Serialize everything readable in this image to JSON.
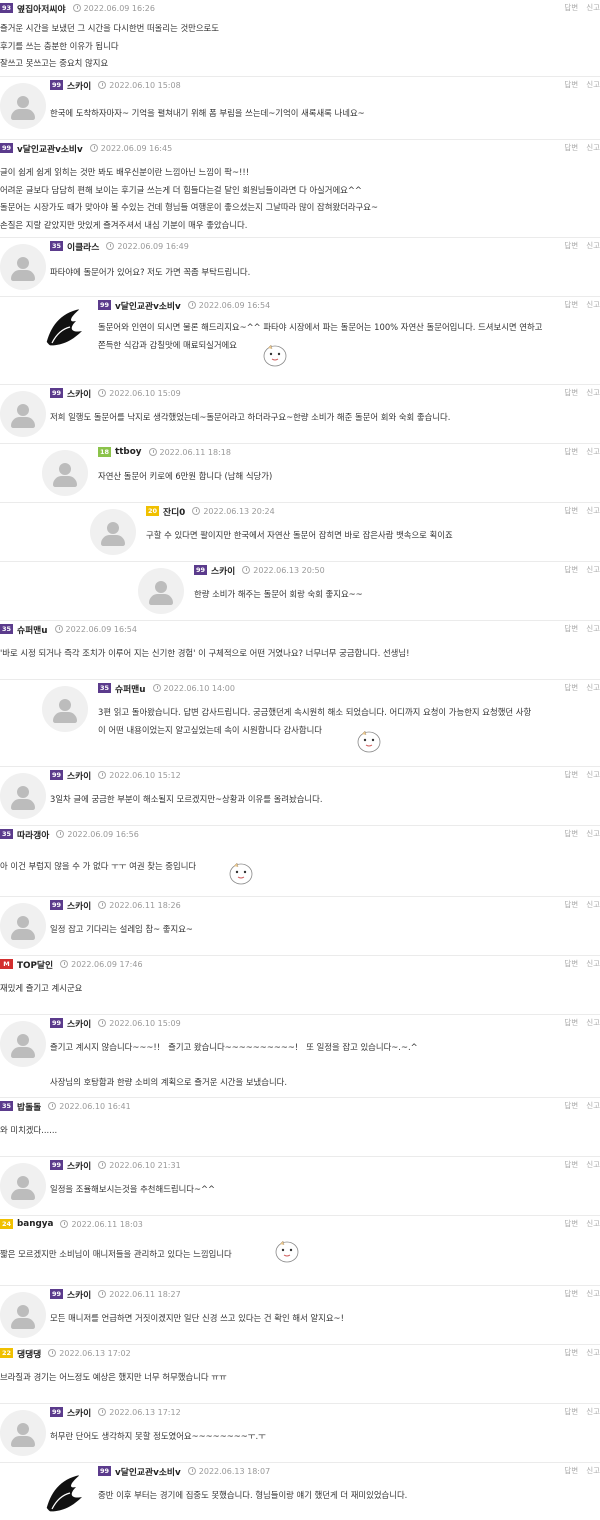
{
  "actions": {
    "reply": "답변",
    "report": "신고"
  },
  "comments": [
    {
      "level": "93",
      "level_color": "#5b3b8c",
      "nick": "옆집아저씨야",
      "date": "2022.06.09 16:26",
      "avatar": "none",
      "lines": [
        "즐거운 시간을 보냈던 그 시간을 다시한번 떠올리는 것만으로도",
        "후기를 쓰는 충분한 이유가 됩니다",
        "잘쓰고 못쓰고는 중요치 않지요"
      ]
    },
    {
      "level": "99",
      "level_color": "#5b3b8c",
      "nick": "스카이",
      "date": "2022.06.10 15:08",
      "avatar": "default",
      "lines": [
        "한국에 도착하자마자~ 기억을 펼쳐내기 위해 폼 부림을 쓰는데~기억이 새록새록 나네요~"
      ]
    },
    {
      "level": "99",
      "level_color": "#5b3b8c",
      "nick": "v달인교관v소비v",
      "date": "2022.06.09 16:45",
      "avatar": "none",
      "lines": [
        "글이 쉽게 쉽게 읽히는 것만 봐도 배우신분이란 느낌아닌 느낌이 팍~!!!",
        "어려운 글보다 담담히 편해 보이는 후기글 쓰는게 더 힘들다는걸 달인 회원님들이라면 다 아실거에요^^",
        "돌문어는 시장가도 때가 맞아야 볼 수있는 건데 형님들 여행운이 좋으셨는지 그날따라 많이 잡혀왔더라구요~",
        "손질은 지랄 같았지만 맛있게 즐겨주셔서 내심 기분이 매우 좋았습니다."
      ]
    },
    {
      "level": "35",
      "level_color": "#5b3b8c",
      "nick": "이클라스",
      "date": "2022.06.09 16:49",
      "avatar": "default",
      "lines": [
        "파타야에 돌문어가 있어요? 저도 가면 꼭좀 부탁드립니다."
      ]
    },
    {
      "level": "99",
      "level_color": "#5b3b8c",
      "nick": "v달인교관v소비v",
      "date": "2022.06.09 16:54",
      "avatar": "dark",
      "emoticon": "emo",
      "lines": [
        "돌문어와 인연이 되시면 물론 해드리지요~^^ 파타야 시장에서 파는 돌문어는 100% 자연산 돌문어입니다. 드셔보시면 연하고",
        "쫀득한 식감과 감칠맛에 매료되실거에요"
      ]
    },
    {
      "level": "99",
      "level_color": "#5b3b8c",
      "nick": "스카이",
      "date": "2022.06.10 15:09",
      "avatar": "default",
      "lines": [
        "저희 일행도 돌문어를 낙지로 생각했었는데~돌문어라고 하더라구요~한량 소비가 해준 돌문어 회와 숙회 좋습니다."
      ]
    },
    {
      "level": "18",
      "level_color": "#8bc34a",
      "nick": "ttboy",
      "date": "2022.06.11 18:18",
      "avatar": "default",
      "lines": [
        "자연산 돌문어 키로에 6만원 합니다 (남해 식당가)"
      ]
    },
    {
      "level": "20",
      "level_color": "#f0c000",
      "nick": "잔디0",
      "date": "2022.06.13 20:24",
      "avatar": "default",
      "lines": [
        "구할 수 있다면 팔이지만 한국에서 자연산 돌문어 잡히면 바로 잡은사람 뱃속으로 획이죠"
      ]
    },
    {
      "level": "99",
      "level_color": "#5b3b8c",
      "nick": "스카이",
      "date": "2022.06.13 20:50",
      "avatar": "default",
      "lines": [
        "한량 소비가 해주는 돌문어 회랑 숙회 좋지요~~"
      ]
    },
    {
      "level": "35",
      "level_color": "#5b3b8c",
      "nick": "슈퍼맨u",
      "date": "2022.06.09 16:54",
      "avatar": "none",
      "lines": [
        "'바로 시정 되거나 즉각 조치가 이루어 지는 신기한 경험' 이 구체적으로 어떤 거였나요? 너무너무 궁금합니다. 선생님!"
      ]
    },
    {
      "level": "35",
      "level_color": "#5b3b8c",
      "nick": "슈퍼맨u",
      "date": "2022.06.10 14:00",
      "avatar": "default",
      "emoticon": "emo",
      "lines": [
        "3편 읽고 돌아왔습니다. 답변 감사드립니다. 궁금했던게 속시원히 해소 되었습니다. 어디까지 요청이 가능한지 요청했던 사항",
        "이 어떤 내용이었는지 알고싶었는데 속이 시원합니다 감사합니다"
      ]
    },
    {
      "level": "99",
      "level_color": "#5b3b8c",
      "nick": "스카이",
      "date": "2022.06.10 15:12",
      "avatar": "default",
      "lines": [
        "3일차 글에 궁금한 부분이 해소될지 모르겠지만~상황과 이유를 올려놨습니다."
      ]
    },
    {
      "level": "35",
      "level_color": "#5b3b8c",
      "nick": "따라갱아",
      "date": "2022.06.09 16:56",
      "avatar": "none",
      "emoticon": "emo",
      "lines": [
        "아 이건 부럽지 않을 수 가 없다 ㅜㅜ 여권 찾는 중입니다"
      ]
    },
    {
      "level": "99",
      "level_color": "#5b3b8c",
      "nick": "스카이",
      "date": "2022.06.11 18:26",
      "avatar": "default",
      "lines": [
        "일정 잡고 기다리는 설레임 참~ 좋지요~"
      ]
    },
    {
      "level": "M",
      "level_color": "#d32f2f",
      "nick": "TOP달인",
      "date": "2022.06.09 17:46",
      "avatar": "none",
      "lines": [
        "재밌게 즐기고 계시군요"
      ]
    },
    {
      "level": "99",
      "level_color": "#5b3b8c",
      "nick": "스카이",
      "date": "2022.06.10 15:09",
      "avatar": "default",
      "lines": [
        "즐기고 계시지 않습니다~~~!!   즐기고 왔습니다~~~~~~~~~~!   또 일정을 잡고 있습니다~.~.^",
        "",
        "사장님의 호탕함과 한량 소비의 계획으로 즐거운 시간을 보냈습니다."
      ]
    },
    {
      "level": "35",
      "level_color": "#5b3b8c",
      "nick": "밥돌돌",
      "date": "2022.06.10 16:41",
      "avatar": "none",
      "lines": [
        "와 미치겠다......"
      ]
    },
    {
      "level": "99",
      "level_color": "#5b3b8c",
      "nick": "스카이",
      "date": "2022.06.10 21:31",
      "avatar": "default",
      "lines": [
        "일정을 조율해보시는것을 추천해드립니다~^^"
      ]
    },
    {
      "level": "24",
      "level_color": "#f0c000",
      "nick": "bangya",
      "date": "2022.06.11 18:03",
      "avatar": "none",
      "emoticon": "emo",
      "lines": [
        "짧은 모르겠지만 소비님이 매니저들을 관리하고 있다는 느낌입니다"
      ]
    },
    {
      "level": "99",
      "level_color": "#5b3b8c",
      "nick": "스카이",
      "date": "2022.06.11 18:27",
      "avatar": "default",
      "lines": [
        "모든 매니저를 언급하면 거짓이겠지만 일단 신경 쓰고 있다는 건 확인 해서 알지요~!"
      ]
    },
    {
      "level": "22",
      "level_color": "#f0c000",
      "nick": "댕댕댕",
      "date": "2022.06.13 17:02",
      "avatar": "none",
      "lines": [
        "브라질과 경기는 어느정도 예상은 했지만 너무 허무했습니다 ㅠㅠ"
      ]
    },
    {
      "level": "99",
      "level_color": "#5b3b8c",
      "nick": "스카이",
      "date": "2022.06.13 17:12",
      "avatar": "default",
      "lines": [
        "허무란 단어도 생각하지 못할 정도였어요~~~~~~~~ㅜ.ㅜ"
      ]
    },
    {
      "level": "99",
      "level_color": "#5b3b8c",
      "nick": "v달인교관v소비v",
      "date": "2022.06.13 18:07",
      "avatar": "dark",
      "lines": [
        "중반 이후 부터는 경기에 집중도 못했습니다. 형님들이랑 얘기 했던게 더 재미있었습니다."
      ]
    }
  ]
}
